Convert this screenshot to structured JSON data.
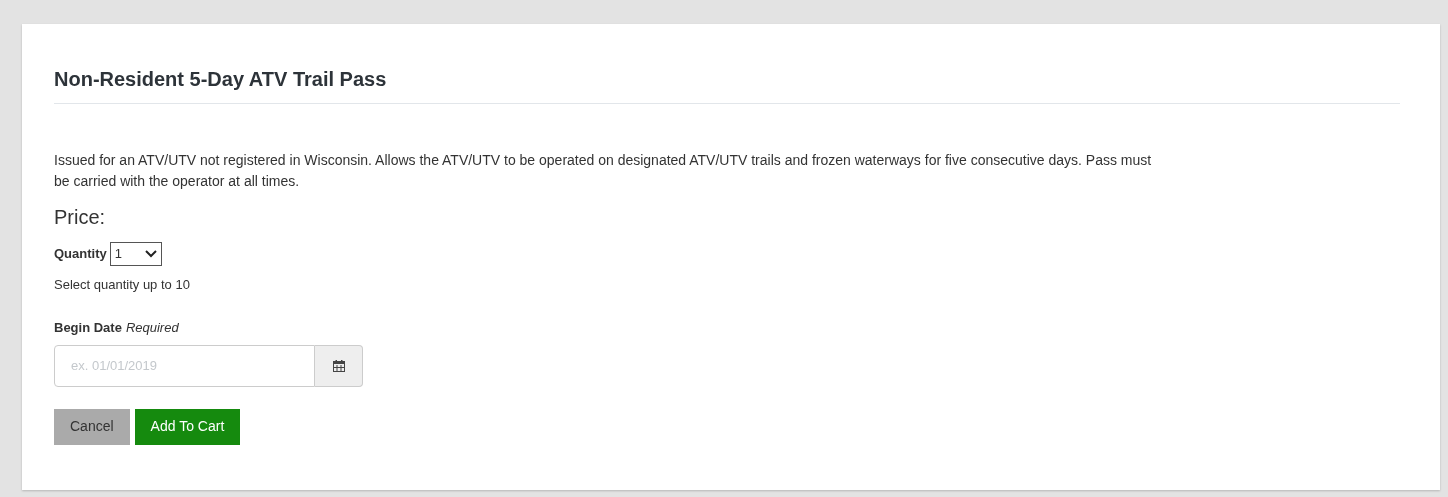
{
  "title": "Non-Resident 5-Day ATV Trail Pass",
  "description": "Issued for an ATV/UTV not registered in Wisconsin. Allows the ATV/UTV to be operated on designated ATV/UTV trails and frozen waterways for five consecutive days. Pass must be carried with the operator at all times.",
  "price_label": "Price:",
  "quantity": {
    "label": "Quantity",
    "value": "1",
    "hint": "Select quantity up to 10"
  },
  "begin_date": {
    "label": "Begin Date",
    "required": "Required",
    "placeholder": "ex. 01/01/2019"
  },
  "buttons": [
    {
      "kind": "cancel",
      "label": "Cancel"
    },
    {
      "kind": "primary",
      "label": "Add To Cart"
    }
  ]
}
